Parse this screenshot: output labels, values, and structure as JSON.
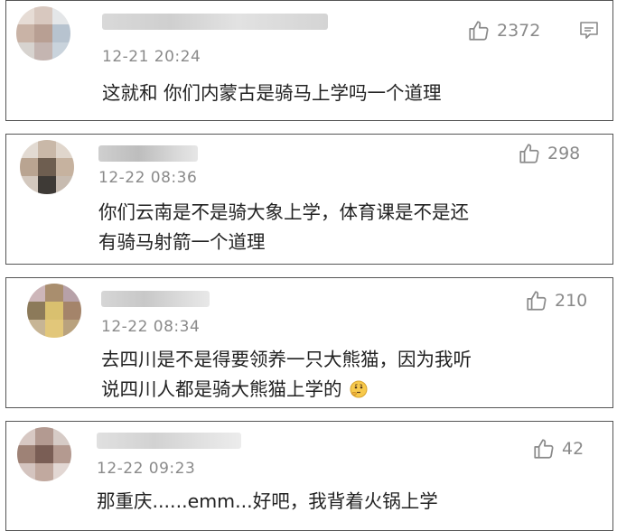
{
  "comments": [
    {
      "time": "12-21 20:24",
      "likes": "2372",
      "lines": [
        "这就和 你们内蒙古是骑马上学吗一个道理"
      ]
    },
    {
      "time": "12-22 08:36",
      "likes": "298",
      "lines": [
        "你们云南是不是骑大象上学，体育课是不是还",
        "有骑马射箭一个道理"
      ]
    },
    {
      "time": "12-22 08:34",
      "likes": "210",
      "lines": [
        "去四川是不是得要领养一只大熊猫，因为我听",
        "说四川人都是骑大熊猫上学的"
      ],
      "emoji": "🤔"
    },
    {
      "time": "12-22 09:23",
      "likes": "42",
      "lines": [
        "那重庆......emm...好吧，我背着火锅上学"
      ]
    }
  ],
  "icons": {
    "like": "thumbs-up-icon",
    "reply": "comment-icon"
  },
  "colors": {
    "meta_gray": "#8a8a8a",
    "text": "#222222",
    "border": "#555555"
  }
}
